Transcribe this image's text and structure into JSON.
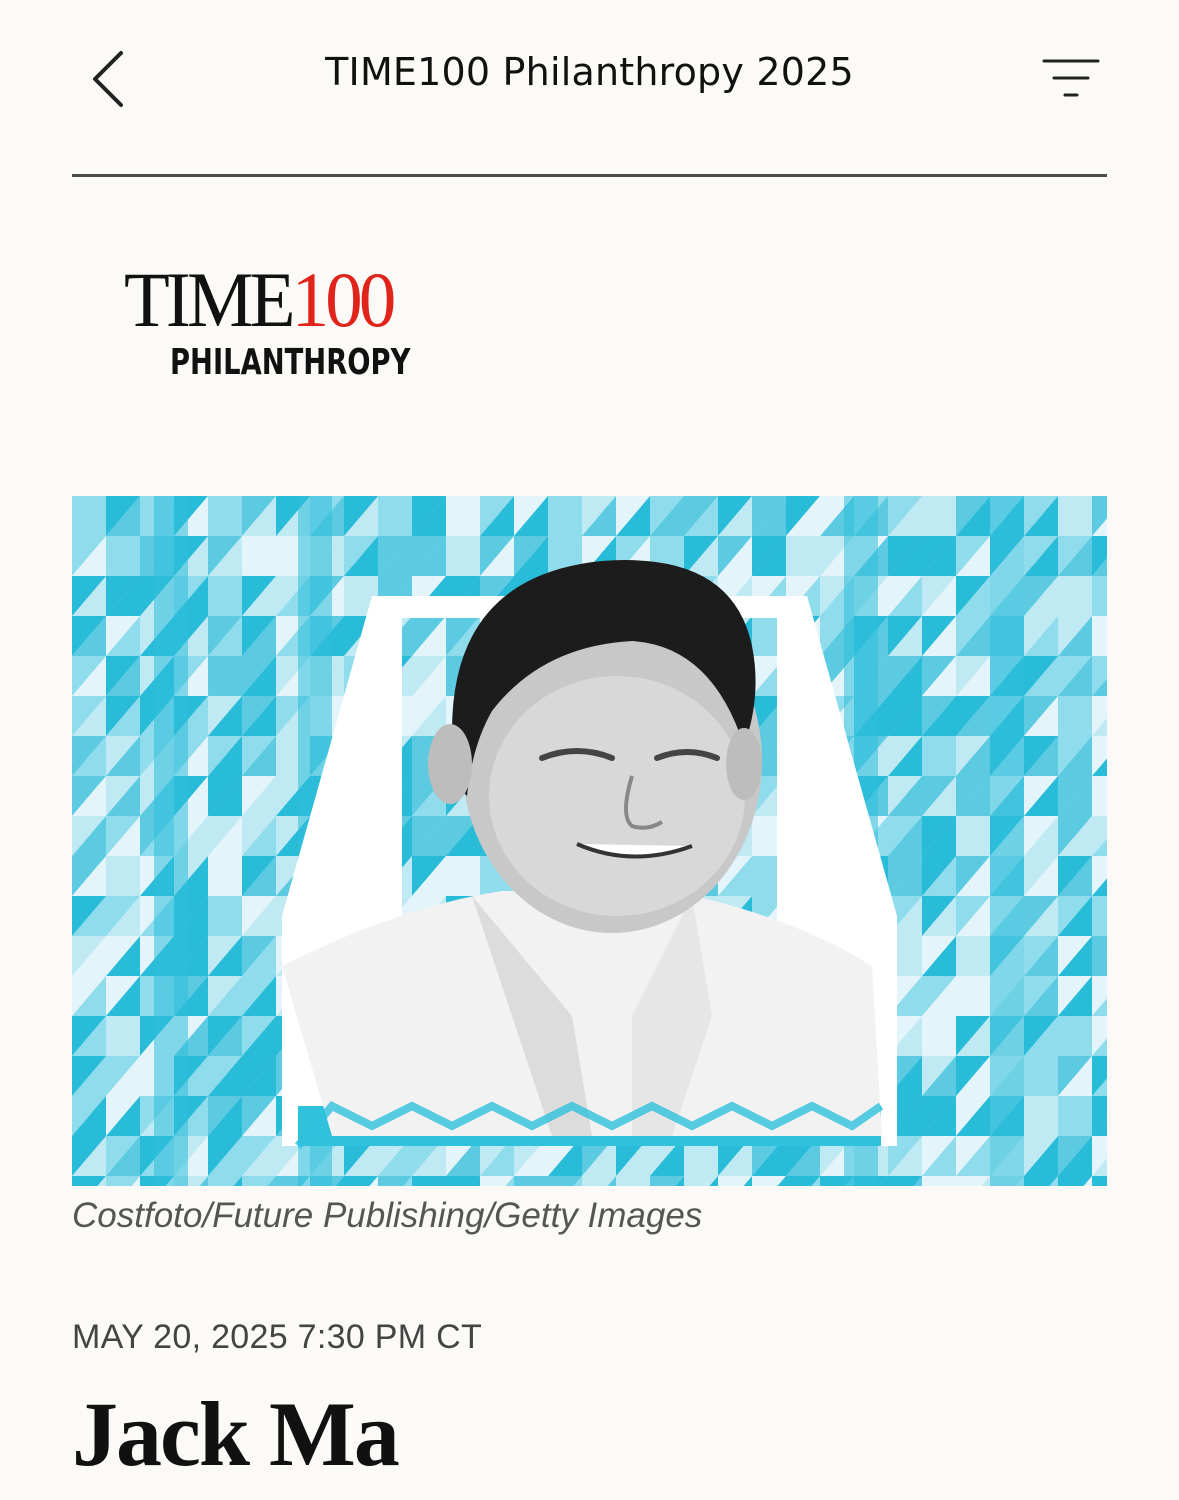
{
  "nav": {
    "title": "TIME100 Philanthropy 2025",
    "back_icon": "chevron-left-icon",
    "menu_icon": "filter-menu-icon"
  },
  "logo": {
    "word": "TIME",
    "number": "100",
    "subtitle": "PHILANTHROPY",
    "accent_color": "#e0231b"
  },
  "hero": {
    "pattern_colors": [
      "#29bcd9",
      "#5ccbe2",
      "#8fdcec",
      "#bfe9f3",
      "#e3f5fa"
    ]
  },
  "article": {
    "photo_credit": "Costfoto/Future Publishing/Getty Images",
    "date": "MAY 20, 2025 7:30 PM CT",
    "headline": "Jack Ma"
  }
}
